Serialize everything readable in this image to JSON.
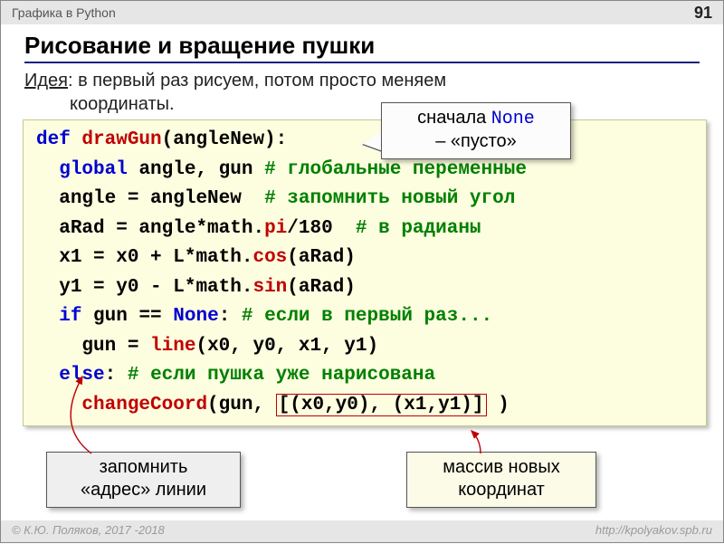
{
  "header": {
    "topic": "Графика в Python",
    "page": "91"
  },
  "title": "Рисование и вращение пушки",
  "idea": {
    "label": "Идея",
    "text1": ": в первый раз рисуем, потом просто меняем",
    "text2": "координаты."
  },
  "code": {
    "l1_def": "def",
    "l1_fn": "drawGun",
    "l1_rest": "(angleNew):",
    "l2_kw": "global",
    "l2_rest": " angle, gun ",
    "l2_cm": "# глобальные переменные",
    "l3a": "angle = angleNew  ",
    "l3_cm": "# запомнить новый угол",
    "l4a": "aRad = angle*math.",
    "l4_pi": "pi",
    "l4b": "/180  ",
    "l4_cm": "# в радианы",
    "l5a": "x1 = x0 + L*math.",
    "l5_cos": "cos",
    "l5b": "(aRad)",
    "l6a": "y1 = y0 - L*math.",
    "l6_sin": "sin",
    "l6b": "(aRad)",
    "l7_if": "if",
    "l7a": " gun == ",
    "l7_none": "None",
    "l7b": ": ",
    "l7_cm": "# если в первый раз...",
    "l8a": "gun = ",
    "l8_line": "line",
    "l8b": "(x0, y0, x1, y1)",
    "l9_else": "else",
    "l9a": ": ",
    "l9_cm": "# если пушка уже нарисована",
    "l10_fn": "changeCoord",
    "l10a": "(gun, ",
    "l10_box": "[(x0,y0), (x1,y1)]",
    "l10b": " )"
  },
  "callouts": {
    "none1": "сначала ",
    "none_code": "None",
    "none2": " – «пусто»",
    "addr1": "запомнить",
    "addr2": "«адрес» линии",
    "arr1": "массив новых",
    "arr2": "координат"
  },
  "footer": {
    "left": "© К.Ю. Поляков, 2017 -2018",
    "right": "http://kpolyakov.spb.ru"
  }
}
